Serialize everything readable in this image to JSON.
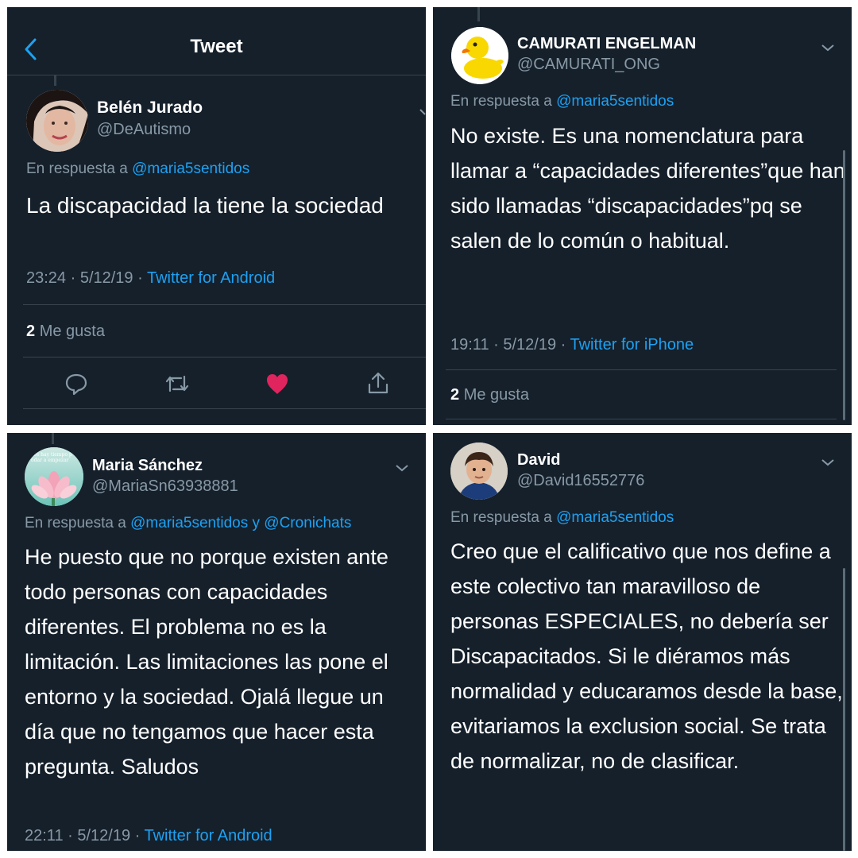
{
  "panels": {
    "p1": {
      "header_title": "Tweet",
      "name": "Belén Jurado",
      "handle": "@DeAutismo",
      "reply_prefix": "En respuesta a",
      "reply_to": "@maria5sentidos",
      "text": "La discapacidad la tiene la sociedad",
      "time": "23:24 · 5/12/19 · ",
      "source": "Twitter for Android",
      "likes_count": "2",
      "likes_label": "Me gusta"
    },
    "p2": {
      "name": "CAMURATI ENGELMAN",
      "handle": "@CAMURATI_ONG",
      "reply_prefix": "En respuesta a",
      "reply_to": "@maria5sentidos",
      "text": "No existe. Es una nomenclatura para llamar a “capacidades diferentes”que han sido llamadas “discapacidades”pq se salen de lo común o habitual.",
      "time": "19:11 · 5/12/19 · ",
      "source": "Twitter for iPhone",
      "likes_count": "2",
      "likes_label": "Me gusta"
    },
    "p3": {
      "name": "Maria Sánchez",
      "handle": "@MariaSn63938881",
      "reply_prefix": "En respuesta a",
      "reply_to": "@maria5sentidos",
      "reply_joiner": "y",
      "reply_to_2": "@Cronichats",
      "avatar_text": "pre hay tiempo p\nodar a empezar",
      "text": "He puesto que no porque existen ante todo personas con capacidades diferentes. El problema no es la limitación. Las limitaciones las pone el entorno y la sociedad. Ojalá llegue un día que no tengamos que hacer esta pregunta. Saludos",
      "time": "22:11 · 5/12/19 · ",
      "source": "Twitter for Android"
    },
    "p4": {
      "name": "David",
      "handle": "@David16552776",
      "reply_prefix": "En respuesta a",
      "reply_to": "@maria5sentidos",
      "text": "Creo que el calificativo que nos define a este colectivo tan maravilloso de personas ESPECIALES, no debería ser Discapacitados. Si le diéramos más normalidad y educaramos desde la base, evitariamos la exclusion social. Se trata de normalizar, no de clasificar."
    }
  },
  "colors": {
    "background": "#15202b",
    "divider": "#38444d",
    "secondary_text": "#8899a6",
    "link": "#1da1f2",
    "like_active": "#e0245e"
  },
  "icons": [
    "back-arrow-icon",
    "chevron-down-icon",
    "reply-icon",
    "retweet-icon",
    "like-heart-icon",
    "share-icon"
  ]
}
